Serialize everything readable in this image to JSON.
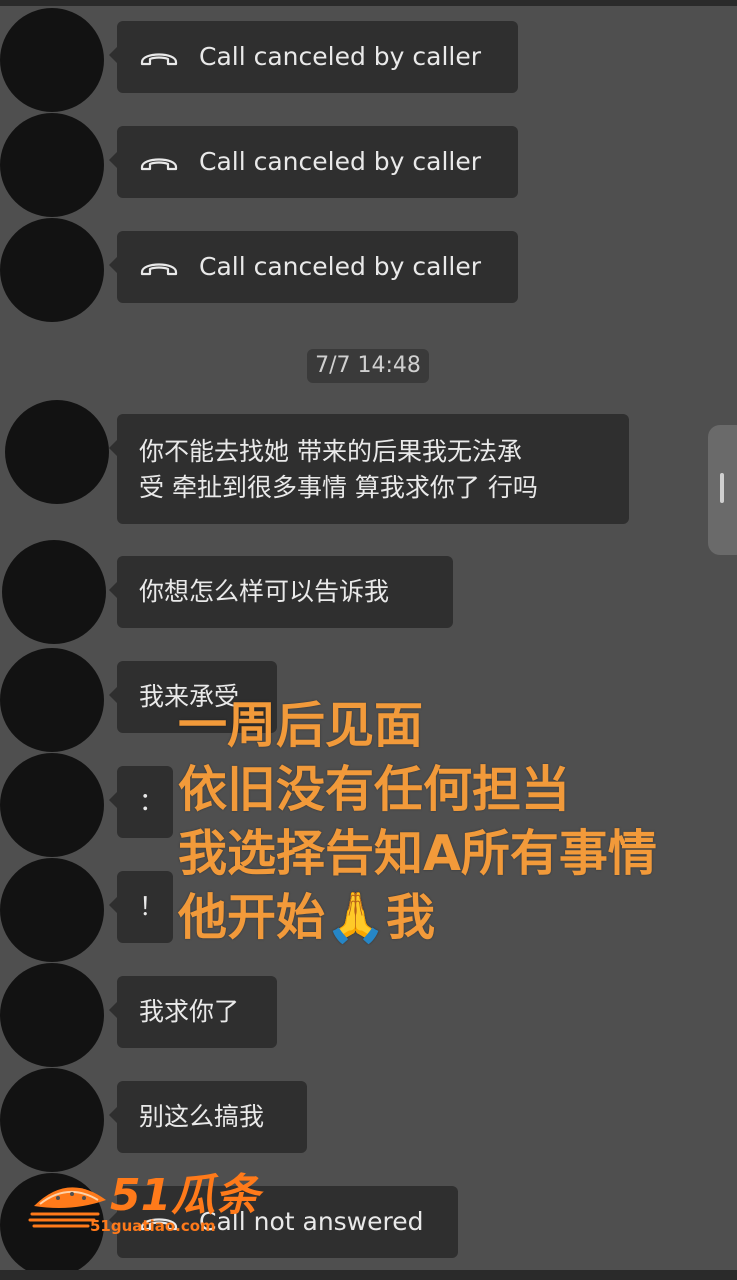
{
  "messages": [
    {
      "type": "call",
      "text": "Call canceled by caller",
      "icon": "phone-hangup-icon"
    },
    {
      "type": "call",
      "text": "Call canceled by caller",
      "icon": "phone-hangup-icon"
    },
    {
      "type": "call",
      "text": "Call canceled by caller",
      "icon": "phone-hangup-icon"
    },
    {
      "type": "text",
      "lines": [
        "你不能去找她 带来的后果我无法承",
        "受 牵扯到很多事情 算我求你了 行吗"
      ]
    },
    {
      "type": "text",
      "text": "你想怎么样可以告诉我"
    },
    {
      "type": "text",
      "text": "我来承受"
    },
    {
      "type": "text",
      "text": "："
    },
    {
      "type": "text",
      "text": "！"
    },
    {
      "type": "text",
      "text": "我求你了"
    },
    {
      "type": "text",
      "text": "别这么搞我"
    },
    {
      "type": "call",
      "text": "Call not answered",
      "icon": "phone-hangup-icon"
    }
  ],
  "timestamp": "7/7 14:48",
  "overlay_caption": [
    "一周后见面",
    "依旧没有任何担当",
    "我选择告知A所有事情",
    "他开始🙏我"
  ],
  "watermark": {
    "brand": "51瓜条",
    "url": "51guatiao.com"
  },
  "colors": {
    "background": "#4f4f4f",
    "bubble": "#2f2f2f",
    "overlay_text": "#f29a3a",
    "watermark": "#ff7a1a"
  }
}
